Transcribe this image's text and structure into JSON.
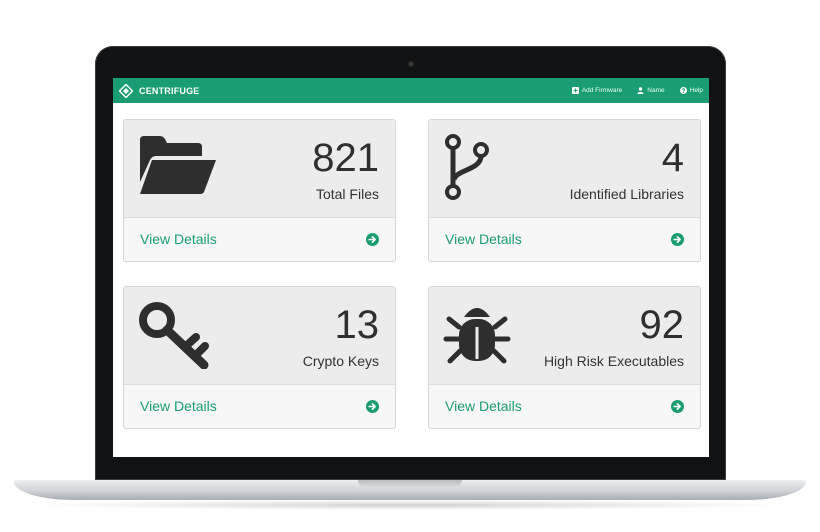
{
  "navbar": {
    "brand": "CENTRIFUGE",
    "links": [
      {
        "label": "Add Firmware",
        "icon": "plus-square-icon"
      },
      {
        "label": "Name",
        "icon": "user-icon"
      },
      {
        "label": "Help",
        "icon": "question-circle-icon"
      }
    ]
  },
  "cards": [
    {
      "count": "821",
      "label": "Total Files",
      "icon": "folder-open-icon",
      "link": "View Details"
    },
    {
      "count": "4",
      "label": "Identified Libraries",
      "icon": "code-fork-icon",
      "link": "View Details"
    },
    {
      "count": "13",
      "label": "Crypto Keys",
      "icon": "key-icon",
      "link": "View Details"
    },
    {
      "count": "92",
      "label": "High Risk Executables",
      "icon": "bug-icon",
      "link": "View Details"
    }
  ],
  "colors": {
    "accent": "#1a9d72",
    "card_top": "#ececec",
    "card_bottom": "#f7f7f7",
    "text_dark": "#2f2f2f"
  }
}
